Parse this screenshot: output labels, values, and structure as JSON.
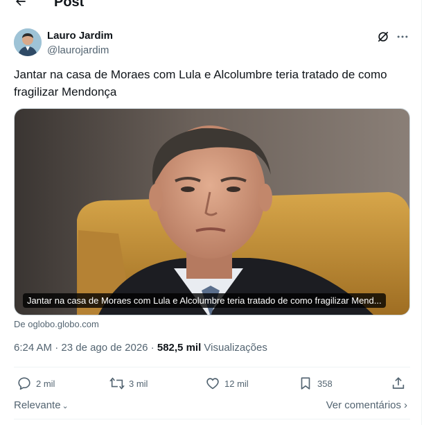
{
  "header": {
    "title": "Post",
    "back_icon": "arrow-left-icon"
  },
  "author": {
    "name": "Lauro Jardim",
    "handle": "@laurojardim"
  },
  "tweet": {
    "text": "Jantar na casa de Moraes com Lula e Alcolumbre teria tratado de como fragilizar Mendonça"
  },
  "card": {
    "caption": "Jantar na casa de Moraes com Lula e Alcolumbre teria tratado de como fragilizar Mend...",
    "source": "De oglobo.globo.com"
  },
  "meta": {
    "time": "6:24 AM",
    "separator": " · ",
    "date": "23 de ago de 2026",
    "views_count": "582,5 mil",
    "views_label": "Visualizações"
  },
  "actions": {
    "replies": "2 mil",
    "reposts": "3 mil",
    "likes": "12 mil",
    "bookmarks": "358"
  },
  "bottom": {
    "sort_label": "Relevante",
    "comments_label": "Ver comentários"
  },
  "colors": {
    "text": "#0f1419",
    "secondary": "#536471",
    "border": "#eff3f4"
  }
}
